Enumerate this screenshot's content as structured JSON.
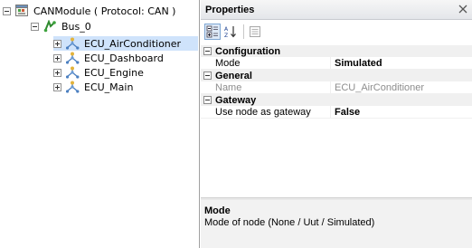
{
  "tree": {
    "root": {
      "label": "CANModule ( Protocol: CAN )"
    },
    "bus": {
      "label": "Bus_0"
    },
    "ecus": [
      {
        "label": "ECU_AirConditioner",
        "selected": true
      },
      {
        "label": "ECU_Dashboard",
        "selected": false
      },
      {
        "label": "ECU_Engine",
        "selected": false
      },
      {
        "label": "ECU_Main",
        "selected": false
      }
    ]
  },
  "properties": {
    "title": "Properties",
    "toolbar": {
      "categorized": "categorized-icon",
      "alphabetical": "sort-az-icon",
      "pages": "property-pages-icon"
    },
    "categories": [
      {
        "name": "Configuration",
        "rows": [
          {
            "name": "Mode",
            "value": "Simulated"
          }
        ]
      },
      {
        "name": "General",
        "rows": [
          {
            "name": "Name",
            "value": "ECU_AirConditioner"
          }
        ]
      },
      {
        "name": "Gateway",
        "rows": [
          {
            "name": "Use node as gateway",
            "value": "False"
          }
        ]
      }
    ],
    "description": {
      "title": "Mode",
      "text": "Mode of node (None / Uut / Simulated)"
    }
  },
  "colors": {
    "selection": "#cfe3fb",
    "header_bg": "#e4e6ea",
    "description_bg": "#f2f2f2",
    "readonly_text": "#8d8d8d"
  }
}
